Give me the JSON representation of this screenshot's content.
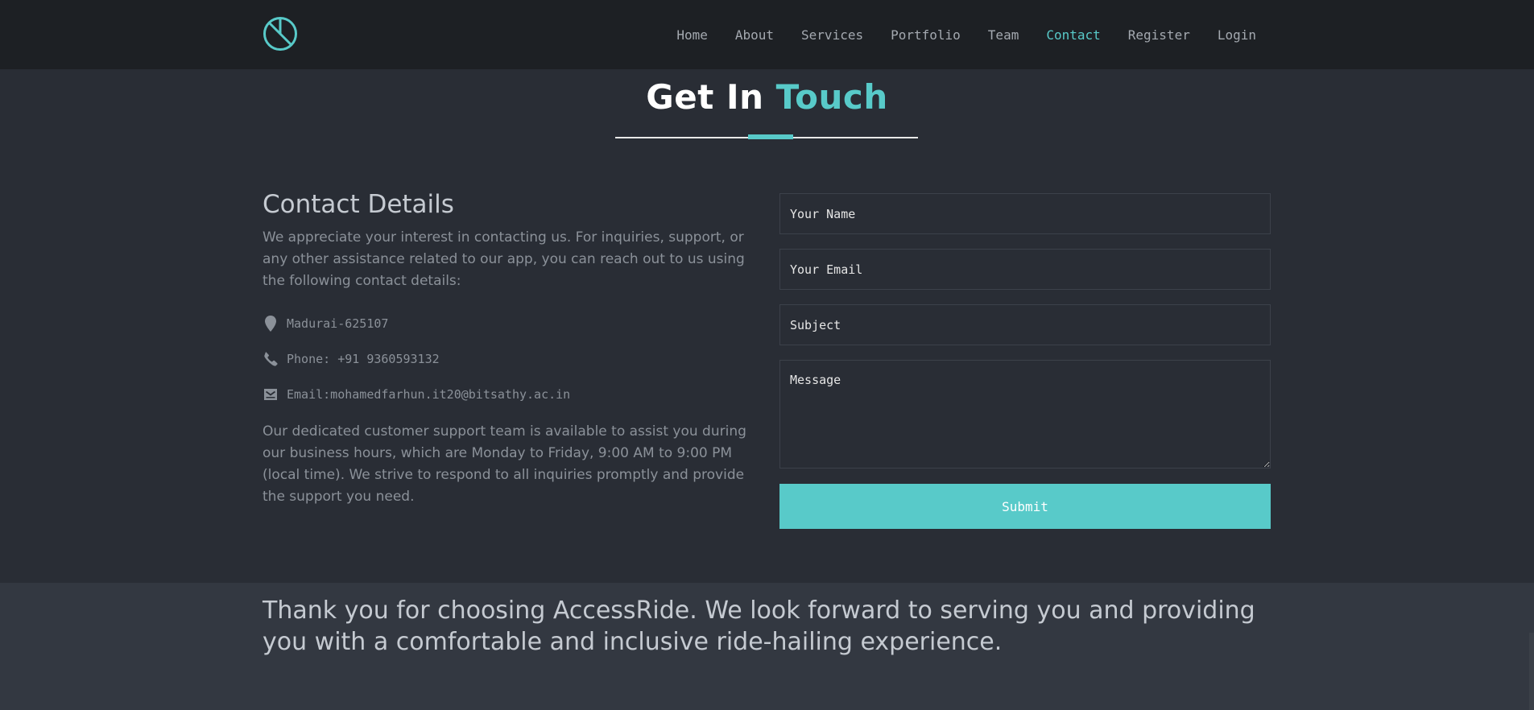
{
  "nav": {
    "logo": "logo-icon",
    "links": [
      {
        "label": "Home"
      },
      {
        "label": "About"
      },
      {
        "label": "Services"
      },
      {
        "label": "Portfolio"
      },
      {
        "label": "Team"
      },
      {
        "label": "Contact",
        "active": true
      },
      {
        "label": "Register"
      },
      {
        "label": "Login"
      }
    ]
  },
  "heading": {
    "part1": "Get In",
    "part2": "Touch"
  },
  "contact": {
    "title": "Contact Details",
    "intro": "We appreciate your interest in contacting us. For inquiries, support, or any other assistance related to our app, you can reach out to us using the following contact details:",
    "items": [
      {
        "icon": "location-pin-icon",
        "text": "Madurai-625107"
      },
      {
        "icon": "phone-icon",
        "text": "Phone: +91 9360593132"
      },
      {
        "icon": "mail-icon",
        "text": "Email:mohamedfarhun.it20@bitsathy.ac.in"
      }
    ],
    "support": "Our dedicated customer support team is available to assist you during our business hours, which are Monday to Friday, 9:00 AM to 9:00 PM (local time). We strive to respond to all inquiries promptly and provide the support you need."
  },
  "form": {
    "name_placeholder": "Your Name",
    "email_placeholder": "Your Email",
    "subject_placeholder": "Subject",
    "message_placeholder": "Message",
    "submit_label": "Submit"
  },
  "footer": {
    "text": "Thank you for choosing AccessRide. We look forward to serving you and providing you with a comfortable and inclusive ride-hailing experience."
  },
  "colors": {
    "accent": "#58cac9",
    "background": "#292d35",
    "navbar": "#1d2024"
  }
}
